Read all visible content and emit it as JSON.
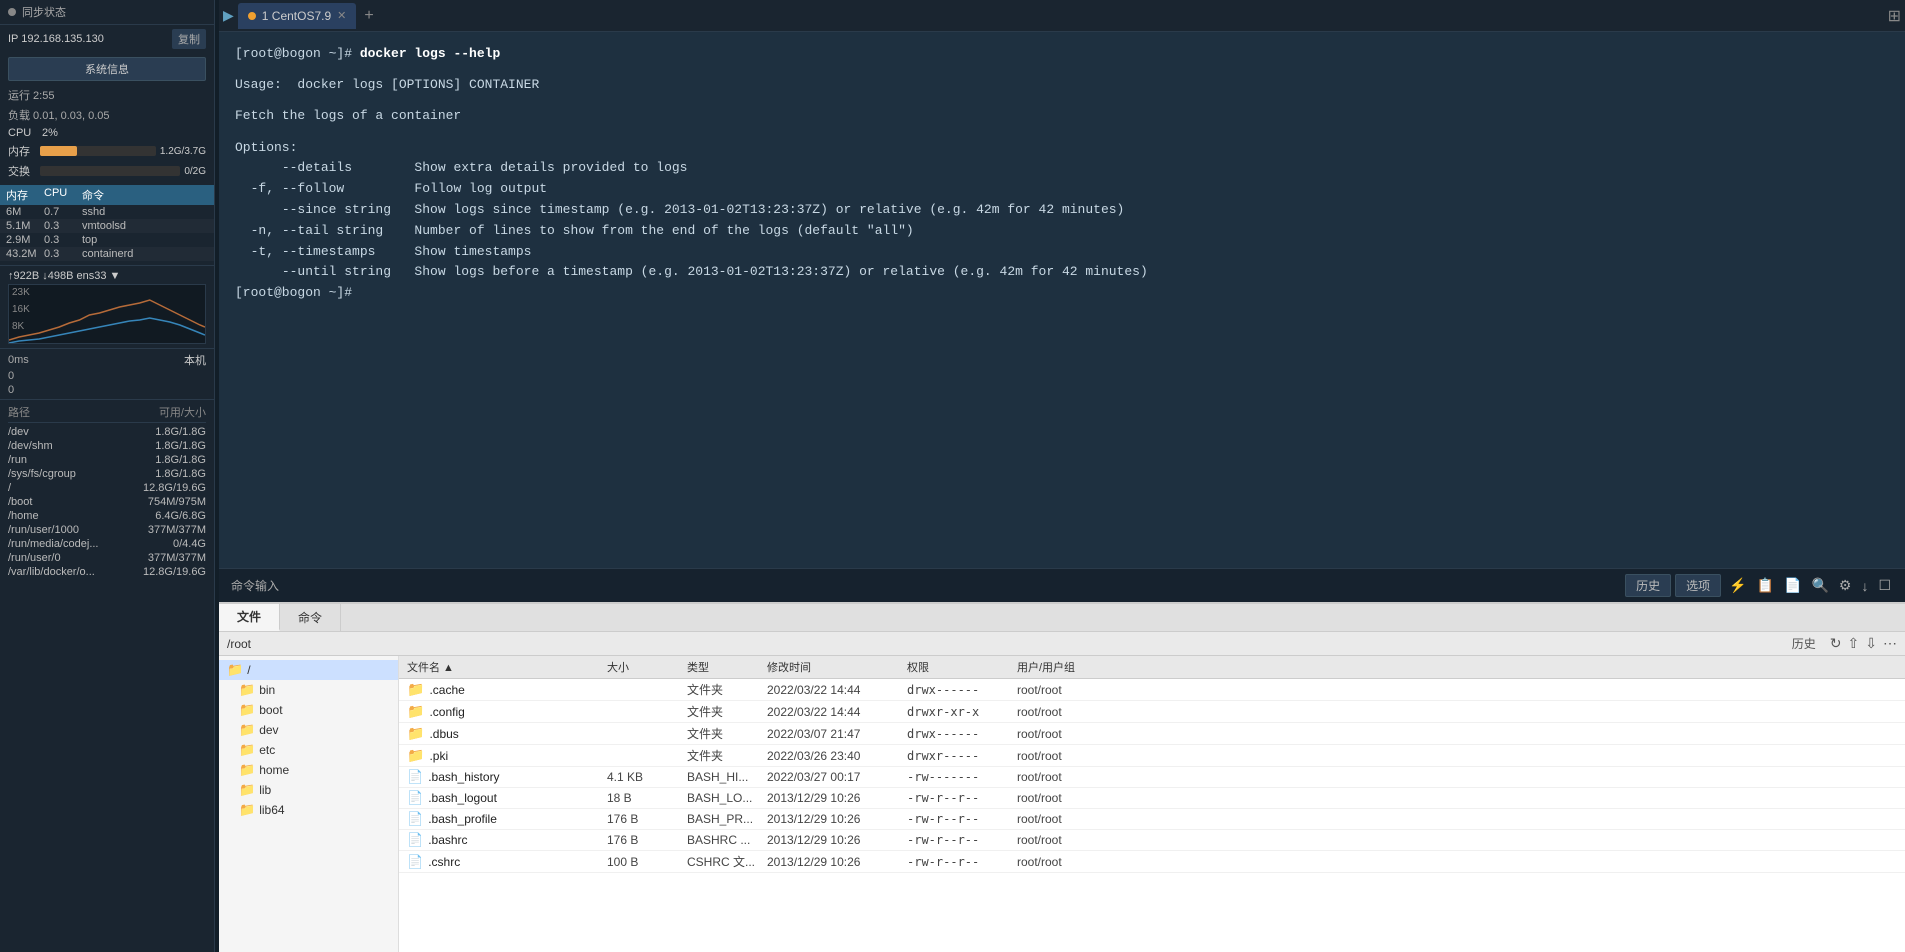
{
  "sidebar": {
    "sync_label": "同步状态",
    "ip": "IP 192.168.135.130",
    "copy_label": "复制",
    "sysinfo_label": "系统信息",
    "uptime_label": "运行 2:55",
    "load_label": "负载 0.01, 0.03, 0.05",
    "cpu_label": "CPU",
    "cpu_val": "2%",
    "mem_label": "内存",
    "mem_percent": 32,
    "mem_val": "1.2G/3.7G",
    "swap_label": "交换",
    "swap_percent": 0,
    "swap_val": "0/2G",
    "proc_headers": [
      "内存",
      "CPU",
      "命令"
    ],
    "processes": [
      {
        "mem": "6M",
        "cpu": "0.7",
        "cmd": "sshd"
      },
      {
        "mem": "5.1M",
        "cpu": "0.3",
        "cmd": "vmtoolsd"
      },
      {
        "mem": "2.9M",
        "cpu": "0.3",
        "cmd": "top"
      },
      {
        "mem": "43.2M",
        "cpu": "0.3",
        "cmd": "containerd"
      }
    ],
    "net_title": "↑922B ↓498B ens33 ▼",
    "net_y_labels": [
      "23K",
      "16K",
      "8K"
    ],
    "latency_label": "0ms",
    "latency_local": "本机",
    "latency_vals": [
      "0",
      "0"
    ],
    "disk_header_path": "路径",
    "disk_header_size": "可用/大小",
    "disks": [
      {
        "path": "/dev",
        "size": "1.8G/1.8G"
      },
      {
        "path": "/dev/shm",
        "size": "1.8G/1.8G"
      },
      {
        "path": "/run",
        "size": "1.8G/1.8G"
      },
      {
        "path": "/sys/fs/cgroup",
        "size": "1.8G/1.8G"
      },
      {
        "path": "/",
        "size": "12.8G/19.6G"
      },
      {
        "path": "/boot",
        "size": "754M/975M"
      },
      {
        "path": "/home",
        "size": "6.4G/6.8G"
      },
      {
        "path": "/run/user/1000",
        "size": "377M/377M"
      },
      {
        "path": "/run/media/codej...",
        "size": "0/4.4G"
      },
      {
        "path": "/run/user/0",
        "size": "377M/377M"
      },
      {
        "path": "/var/lib/docker/o...",
        "size": "12.8G/19.6G"
      }
    ]
  },
  "tabs": [
    {
      "label": "1 CentOS7.9",
      "active": true
    }
  ],
  "tab_add": "+",
  "terminal": {
    "lines": [
      {
        "type": "prompt-cmd",
        "prompt": "[root@bogon ~]# ",
        "cmd": "docker logs --help"
      },
      {
        "type": "blank"
      },
      {
        "type": "output",
        "text": "Usage:  docker logs [OPTIONS] CONTAINER"
      },
      {
        "type": "blank"
      },
      {
        "type": "output",
        "text": "Fetch the logs of a container"
      },
      {
        "type": "blank"
      },
      {
        "type": "output",
        "text": "Options:"
      },
      {
        "type": "output",
        "text": "      --details        Show extra details provided to logs"
      },
      {
        "type": "output",
        "text": "  -f, --follow         Follow log output"
      },
      {
        "type": "output",
        "text": "      --since string   Show logs since timestamp (e.g. 2013-01-02T13:23:37Z) or relative (e.g. 42m for 42 minutes)"
      },
      {
        "type": "output",
        "text": "  -n, --tail string    Number of lines to show from the end of the logs (default \"all\")"
      },
      {
        "type": "output",
        "text": "  -t, --timestamps     Show timestamps"
      },
      {
        "type": "output",
        "text": "      --until string   Show logs before a timestamp (e.g. 2013-01-02T13:23:37Z) or relative (e.g. 42m for 42 minutes)"
      },
      {
        "type": "prompt-only",
        "prompt": "[root@bogon ~]# "
      }
    ]
  },
  "toolbar": {
    "input_label": "命令输入",
    "history_label": "历史",
    "options_label": "选项"
  },
  "file_panel": {
    "tabs": [
      "文件",
      "命令"
    ],
    "active_tab": "文件",
    "path": "/root",
    "history_label": "历史",
    "col_headers": [
      "文件名 ▲",
      "大小",
      "类型",
      "修改时间",
      "权限",
      "用户/用户组"
    ],
    "tree_items": [
      {
        "label": "/",
        "type": "folder",
        "level": 0
      },
      {
        "label": "bin",
        "type": "folder",
        "level": 1
      },
      {
        "label": "boot",
        "type": "folder",
        "level": 1
      },
      {
        "label": "dev",
        "type": "folder",
        "level": 1
      },
      {
        "label": "etc",
        "type": "folder",
        "level": 1
      },
      {
        "label": "home",
        "type": "folder",
        "level": 1
      },
      {
        "label": "lib",
        "type": "folder",
        "level": 1
      },
      {
        "label": "lib64",
        "type": "folder",
        "level": 1
      }
    ],
    "files": [
      {
        "name": ".cache",
        "size": "",
        "type": "文件夹",
        "mtime": "2022/03/22 14:44",
        "perm": "drwx------",
        "owner": "root/root"
      },
      {
        "name": ".config",
        "size": "",
        "type": "文件夹",
        "mtime": "2022/03/22 14:44",
        "perm": "drwxr-xr-x",
        "owner": "root/root"
      },
      {
        "name": ".dbus",
        "size": "",
        "type": "文件夹",
        "mtime": "2022/03/07 21:47",
        "perm": "drwx------",
        "owner": "root/root"
      },
      {
        "name": ".pki",
        "size": "",
        "type": "文件夹",
        "mtime": "2022/03/26 23:40",
        "perm": "drwxr-----",
        "owner": "root/root"
      },
      {
        "name": ".bash_history",
        "size": "4.1 KB",
        "type": "BASH_HI...",
        "mtime": "2022/03/27 00:17",
        "perm": "-rw-------",
        "owner": "root/root"
      },
      {
        "name": ".bash_logout",
        "size": "18 B",
        "type": "BASH_LO...",
        "mtime": "2013/12/29 10:26",
        "perm": "-rw-r--r--",
        "owner": "root/root"
      },
      {
        "name": ".bash_profile",
        "size": "176 B",
        "type": "BASH_PR...",
        "mtime": "2013/12/29 10:26",
        "perm": "-rw-r--r--",
        "owner": "root/root"
      },
      {
        "name": ".bashrc",
        "size": "176 B",
        "type": "BASHRC ...",
        "mtime": "2013/12/29 10:26",
        "perm": "-rw-r--r--",
        "owner": "root/root"
      },
      {
        "name": ".cshrc",
        "size": "100 B",
        "type": "CSHRC 文...",
        "mtime": "2013/12/29 10:26",
        "perm": "-rw-r--r--",
        "owner": "root/root"
      }
    ]
  }
}
